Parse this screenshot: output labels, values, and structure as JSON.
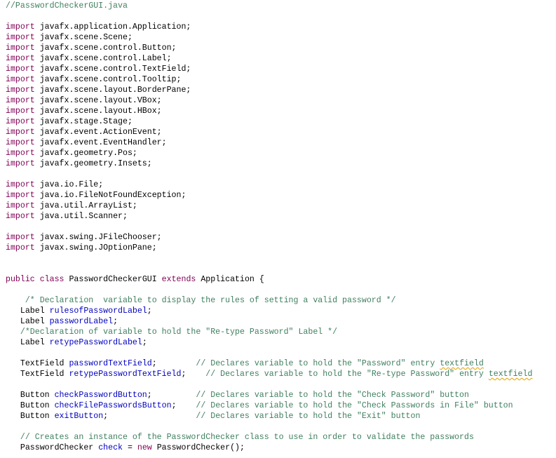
{
  "editor": {
    "file_comment": "//PasswordCheckerGUI.java",
    "colors": {
      "keyword": "#7F0055",
      "comment": "#3F7F5F",
      "field": "#0000C0",
      "text": "#000000"
    },
    "lines": [
      [
        [
          "cm",
          "//PasswordCheckerGUI.java"
        ]
      ],
      [],
      [
        [
          "kw",
          "import"
        ],
        [
          "tx",
          " javafx.application.Application;"
        ]
      ],
      [
        [
          "kw",
          "import"
        ],
        [
          "tx",
          " javafx.scene.Scene;"
        ]
      ],
      [
        [
          "kw",
          "import"
        ],
        [
          "tx",
          " javafx.scene.control.Button;"
        ]
      ],
      [
        [
          "kw",
          "import"
        ],
        [
          "tx",
          " javafx.scene.control.Label;"
        ]
      ],
      [
        [
          "kw",
          "import"
        ],
        [
          "tx",
          " javafx.scene.control.TextField;"
        ]
      ],
      [
        [
          "kw",
          "import"
        ],
        [
          "tx",
          " javafx.scene.control.Tooltip;"
        ]
      ],
      [
        [
          "kw",
          "import"
        ],
        [
          "tx",
          " javafx.scene.layout.BorderPane;"
        ]
      ],
      [
        [
          "kw",
          "import"
        ],
        [
          "tx",
          " javafx.scene.layout.VBox;"
        ]
      ],
      [
        [
          "kw",
          "import"
        ],
        [
          "tx",
          " javafx.scene.layout.HBox;"
        ]
      ],
      [
        [
          "kw",
          "import"
        ],
        [
          "tx",
          " javafx.stage.Stage;"
        ]
      ],
      [
        [
          "kw",
          "import"
        ],
        [
          "tx",
          " javafx.event.ActionEvent;"
        ]
      ],
      [
        [
          "kw",
          "import"
        ],
        [
          "tx",
          " javafx.event.EventHandler;"
        ]
      ],
      [
        [
          "kw",
          "import"
        ],
        [
          "tx",
          " javafx.geometry.Pos;"
        ]
      ],
      [
        [
          "kw",
          "import"
        ],
        [
          "tx",
          " javafx.geometry.Insets;"
        ]
      ],
      [],
      [
        [
          "kw",
          "import"
        ],
        [
          "tx",
          " java.io.File;"
        ]
      ],
      [
        [
          "kw",
          "import"
        ],
        [
          "tx",
          " java.io.FileNotFoundException;"
        ]
      ],
      [
        [
          "kw",
          "import"
        ],
        [
          "tx",
          " java.util.ArrayList;"
        ]
      ],
      [
        [
          "kw",
          "import"
        ],
        [
          "tx",
          " java.util.Scanner;"
        ]
      ],
      [],
      [
        [
          "kw",
          "import"
        ],
        [
          "tx",
          " javax.swing.JFileChooser;"
        ]
      ],
      [
        [
          "kw",
          "import"
        ],
        [
          "tx",
          " javax.swing.JOptionPane;"
        ]
      ],
      [],
      [],
      [
        [
          "kw",
          "public"
        ],
        [
          "tx",
          " "
        ],
        [
          "kw",
          "class"
        ],
        [
          "tx",
          " PasswordCheckerGUI "
        ],
        [
          "kw",
          "extends"
        ],
        [
          "tx",
          " Application {"
        ]
      ],
      [],
      [
        [
          "cm",
          "    /* Declaration  variable to display the rules of setting a valid password */"
        ]
      ],
      [
        [
          "tx",
          "   Label "
        ],
        [
          "fd",
          "rulesofPasswordLabel"
        ],
        [
          "tx",
          ";"
        ]
      ],
      [
        [
          "tx",
          "   Label "
        ],
        [
          "fd",
          "passwordLabel"
        ],
        [
          "tx",
          ";"
        ]
      ],
      [
        [
          "cm",
          "   /*Declaration of variable to hold the \"Re-type Password\" Label */"
        ]
      ],
      [
        [
          "tx",
          "   Label "
        ],
        [
          "fd",
          "retypePasswordLabel"
        ],
        [
          "tx",
          ";"
        ]
      ],
      [],
      [
        [
          "tx",
          "   TextField "
        ],
        [
          "fd",
          "passwordTextField"
        ],
        [
          "tx",
          ";        "
        ],
        [
          "cm",
          "// Declares variable to hold the \"Password\" entry "
        ],
        [
          "sp",
          "textfield"
        ]
      ],
      [
        [
          "tx",
          "   TextField "
        ],
        [
          "fd",
          "retypePasswordTextField"
        ],
        [
          "tx",
          ";    "
        ],
        [
          "cm",
          "// Declares variable to hold the \"Re-type Password\" entry "
        ],
        [
          "sp",
          "textfield"
        ]
      ],
      [],
      [
        [
          "tx",
          "   Button "
        ],
        [
          "fd",
          "checkPasswordButton"
        ],
        [
          "tx",
          ";         "
        ],
        [
          "cm",
          "// Declares variable to hold the \"Check Password\" button"
        ]
      ],
      [
        [
          "tx",
          "   Button "
        ],
        [
          "fd",
          "checkFilePasswordsButton"
        ],
        [
          "tx",
          ";    "
        ],
        [
          "cm",
          "// Declares variable to hold the \"Check Passwords in File\" button"
        ]
      ],
      [
        [
          "tx",
          "   Button "
        ],
        [
          "fd",
          "exitButton"
        ],
        [
          "tx",
          ";                  "
        ],
        [
          "cm",
          "// Declares variable to hold the \"Exit\" button"
        ]
      ],
      [],
      [
        [
          "cm",
          "   // Creates an instance of the PasswordChecker class to use in order to validate the passwords"
        ]
      ],
      [
        [
          "tx",
          "   PasswordChecker "
        ],
        [
          "fd",
          "check"
        ],
        [
          "tx",
          " = "
        ],
        [
          "kw",
          "new"
        ],
        [
          "tx",
          " PasswordChecker();"
        ]
      ]
    ]
  }
}
